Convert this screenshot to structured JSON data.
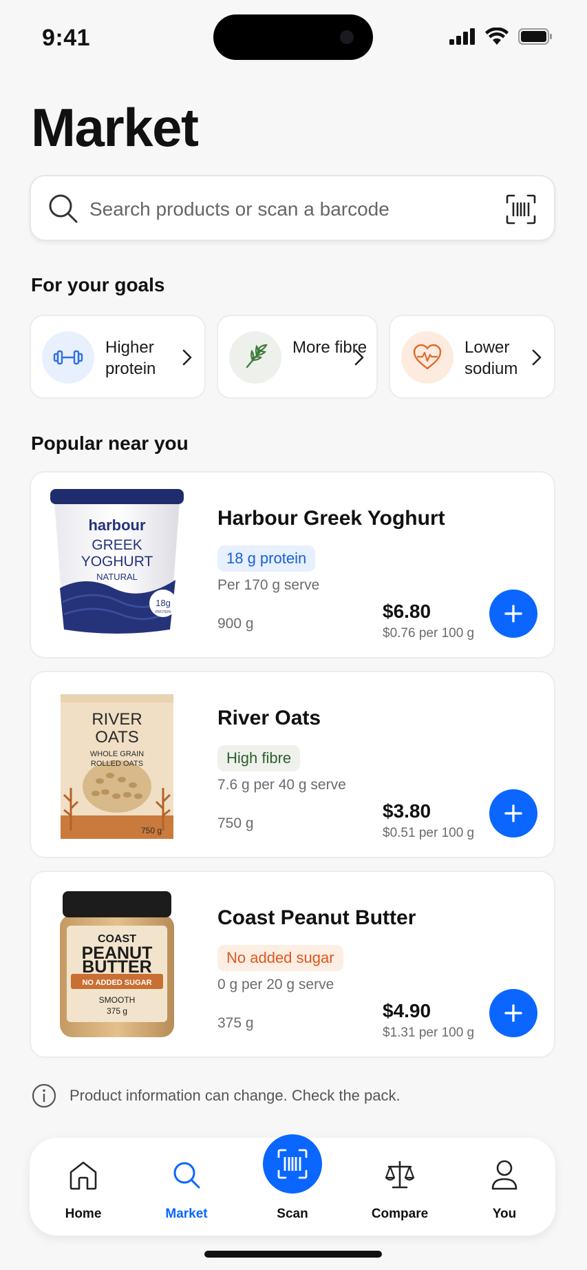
{
  "status_bar": {
    "time": "9:41"
  },
  "page": {
    "title": "Market"
  },
  "search": {
    "placeholder": "Search products or scan a barcode"
  },
  "goals": {
    "title": "For your goals",
    "items": [
      {
        "label": "Higher protein",
        "icon": "dumbbell-icon",
        "bg": "#e8f0fe",
        "color": "#2f6fe0"
      },
      {
        "label": "More fibre",
        "icon": "leaf-icon",
        "bg": "#eef0ec",
        "color": "#3d7a3a"
      },
      {
        "label": "Lower sodium",
        "icon": "heart-pulse-icon",
        "bg": "#fdebe0",
        "color": "#e06a2c"
      }
    ]
  },
  "popular": {
    "title": "Popular near you",
    "products": [
      {
        "name": "Harbour Greek Yoghurt",
        "tag": "18 g protein",
        "tag_bg": "#e6f0ff",
        "tag_color": "#1a5fd6",
        "serve": "Per 170 g serve",
        "size": "900 g",
        "price": "$6.80",
        "unit_price": "$0.76 per 100 g",
        "pack": {
          "brand": "harbour",
          "line1": "GREEK",
          "line2": "YOGHURT",
          "line3": "NATURAL",
          "badge": "18g",
          "badge_sub": "PROTEIN"
        }
      },
      {
        "name": "River Oats",
        "tag": "High fibre",
        "tag_bg": "#eef1ec",
        "tag_color": "#2f5f2a",
        "serve": "7.6 g per 40 g serve",
        "size": "750 g",
        "price": "$3.80",
        "unit_price": "$0.51 per 100 g",
        "pack": {
          "line1": "RIVER",
          "line2": "OATS",
          "line3": "WHOLE GRAIN",
          "line4": "ROLLED OATS",
          "weight": "750 g"
        }
      },
      {
        "name": "Coast Peanut Butter",
        "tag": "No added sugar",
        "tag_bg": "#fdeee4",
        "tag_color": "#e0571a",
        "serve": "0 g per 20 g serve",
        "size": "375 g",
        "price": "$4.90",
        "unit_price": "$1.31 per 100 g",
        "pack": {
          "line1": "COAST",
          "line2": "PEANUT",
          "line3": "BUTTER",
          "band": "NO ADDED SUGAR",
          "line4": "SMOOTH",
          "weight": "375 g"
        }
      }
    ]
  },
  "disclaimer": "Product information can change. Check the pack.",
  "nav": {
    "items": [
      {
        "label": "Home",
        "icon": "home-icon"
      },
      {
        "label": "Market",
        "icon": "search-icon",
        "active": true
      },
      {
        "label": "Scan",
        "icon": "barcode-scan-icon"
      },
      {
        "label": "Compare",
        "icon": "scale-icon"
      },
      {
        "label": "You",
        "icon": "person-icon"
      }
    ]
  },
  "colors": {
    "accent": "#0a66ff",
    "background": "#f7f7f7"
  }
}
